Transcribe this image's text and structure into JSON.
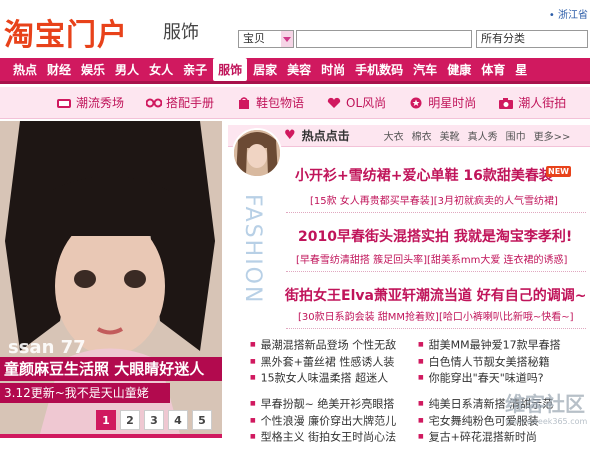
{
  "header": {
    "logo": "淘宝门户",
    "section": "服饰",
    "region": "• 浙江省",
    "search_type": "宝贝",
    "search_value": "",
    "category": "所有分类"
  },
  "nav": [
    "热点",
    "财经",
    "娱乐",
    "男人",
    "女人",
    "亲子",
    "服饰",
    "居家",
    "美容",
    "时尚",
    "手机数码",
    "汽车",
    "健康",
    "体育",
    "星"
  ],
  "nav_active": "服饰",
  "subnav": [
    {
      "label": "潮流秀场",
      "icon": "tv-icon"
    },
    {
      "label": "搭配手册",
      "icon": "glasses-icon"
    },
    {
      "label": "鞋包物语",
      "icon": "bag-icon"
    },
    {
      "label": "OL风尚",
      "icon": "heart-icon"
    },
    {
      "label": "明星时尚",
      "icon": "star-icon"
    },
    {
      "label": "潮人街拍",
      "icon": "camera-icon"
    }
  ],
  "hero": {
    "overlay_text": "ssan 77",
    "caption": "童颜麻豆生活照 大眼睛好迷人",
    "subcaption": "3.12更新~我不是天山童姥",
    "pages": [
      "1",
      "2",
      "3",
      "4",
      "5"
    ],
    "active_page": "1"
  },
  "hot": {
    "title": "热点点击",
    "tags": [
      "大衣",
      "棉衣",
      "美靴",
      "真人秀",
      "围巾"
    ],
    "more": "更多>>",
    "fashion_text": "FASHION",
    "new_badge": "NEW",
    "headlines": [
      {
        "title": "小开衫+雪纺裙+爱心单鞋 16款甜美春装",
        "sub": "[15款 女人再贵都买早春装][3月初就疯卖的人气雪纺裙]"
      },
      {
        "title": "2010早春街头混搭实拍 我就是淘宝李孝利!",
        "sub": "[早春雪纺清甜搭 簇足回头率][甜美系mm大爱 连衣裙的诱惑]"
      },
      {
        "title": "街拍女王Elva萧亚轩潮流当道 好有自己的调调~",
        "sub": "[30款日系韵会装 甜MM抢着败][哈口小裤喇叭比新哦~快看~]"
      }
    ]
  },
  "lists": {
    "left_1": [
      "最潮混搭新品登场 个性无敌",
      "黑外套+蕾丝裙 性感诱人装",
      "15款女人味温柔搭 超迷人"
    ],
    "right_1": [
      "甜美MM最钟爱17款早春搭",
      "白色情人节靓女美搭秘籍",
      "你能穿出\"春天\"味道吗?"
    ],
    "left_2": [
      "早春扮靓~ 绝美开衫亮眼搭",
      "个性浪漫 廉价穿出大牌范儿",
      "型格主义 街拍女王时尚心法"
    ],
    "right_2": [
      "纯美日系清新搭 清甜示范",
      "宅女舞纯粉色可爱服装",
      "复古+碎花混搭新时尚"
    ]
  },
  "watermark": {
    "text": "维客社区",
    "url": "www.eweek365.com"
  }
}
